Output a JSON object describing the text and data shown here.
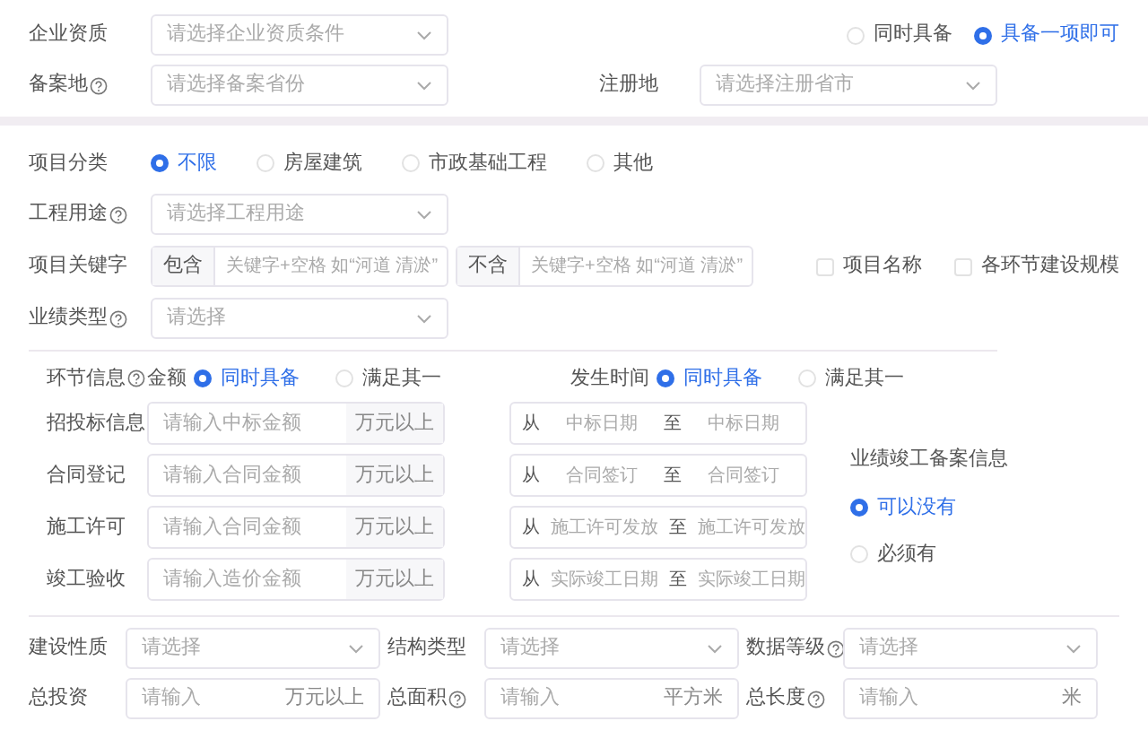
{
  "qualification": {
    "label": "企业资质",
    "placeholder": "请选择企业资质条件",
    "options": [
      {
        "label": "同时具备",
        "selected": false
      },
      {
        "label": "具备一项即可",
        "selected": true
      }
    ]
  },
  "filing": {
    "label": "备案地",
    "help": true,
    "placeholder": "请选择备案省份"
  },
  "registration": {
    "label": "注册地",
    "help": false,
    "placeholder": "请选择注册省市"
  },
  "project_category": {
    "label": "项目分类",
    "options": [
      {
        "label": "不限",
        "selected": true
      },
      {
        "label": "房屋建筑",
        "selected": false
      },
      {
        "label": "市政基础工程",
        "selected": false
      },
      {
        "label": "其他",
        "selected": false
      }
    ]
  },
  "engineering_use": {
    "label": "工程用途",
    "help": true,
    "placeholder": "请选择工程用途"
  },
  "keywords": {
    "label": "项目关键字",
    "include": {
      "label": "包含",
      "placeholder": "关键字+空格 如“河道 清淤”"
    },
    "exclude": {
      "label": "不含",
      "placeholder": "关键字+空格 如“河道 清淤”"
    },
    "scopes": [
      {
        "label": "项目名称",
        "checked": false
      },
      {
        "label": "各环节建设规模",
        "checked": false
      }
    ]
  },
  "performance_type": {
    "label": "业绩类型",
    "help": true,
    "placeholder": "请选择"
  },
  "stage_info": {
    "label": "环节信息",
    "help": true,
    "amount": {
      "label": "金额",
      "options": [
        {
          "label": "同时具备",
          "selected": true
        },
        {
          "label": "满足其一",
          "selected": false
        }
      ]
    },
    "time": {
      "label": "发生时间",
      "options": [
        {
          "label": "同时具备",
          "selected": true
        },
        {
          "label": "满足其一",
          "selected": false
        }
      ]
    },
    "rows": [
      {
        "label": "招投标信息",
        "amount_placeholder": "请输入中标金额",
        "unit": "万元以上",
        "from": "从",
        "start_placeholder": "中标日期",
        "to": "至",
        "end_placeholder": "中标日期"
      },
      {
        "label": "合同登记",
        "amount_placeholder": "请输入合同金额",
        "unit": "万元以上",
        "from": "从",
        "start_placeholder": "合同签订",
        "to": "至",
        "end_placeholder": "合同签订"
      },
      {
        "label": "施工许可",
        "amount_placeholder": "请输入合同金额",
        "unit": "万元以上",
        "from": "从",
        "start_placeholder": "施工许可发放",
        "to": "至",
        "end_placeholder": "施工许可发放"
      },
      {
        "label": "竣工验收",
        "amount_placeholder": "请输入造价金额",
        "unit": "万元以上",
        "from": "从",
        "start_placeholder": "实际竣工日期",
        "to": "至",
        "end_placeholder": "实际竣工日期"
      }
    ],
    "completion_filing": {
      "label": "业绩竣工备案信息",
      "options": [
        {
          "label": "可以没有",
          "selected": true
        },
        {
          "label": "必须有",
          "selected": false
        }
      ]
    }
  },
  "selects": [
    {
      "label": "建设性质",
      "help": false,
      "placeholder": "请选择"
    },
    {
      "label": "结构类型",
      "help": false,
      "placeholder": "请选择"
    },
    {
      "label": "数据等级",
      "help": true,
      "placeholder": "请选择"
    }
  ],
  "inputs": [
    {
      "label": "总投资",
      "help": false,
      "placeholder": "请输入",
      "unit": "万元以上"
    },
    {
      "label": "总面积",
      "help": true,
      "placeholder": "请输入",
      "unit": "平方米"
    },
    {
      "label": "总长度",
      "help": true,
      "placeholder": "请输入",
      "unit": "米"
    }
  ]
}
